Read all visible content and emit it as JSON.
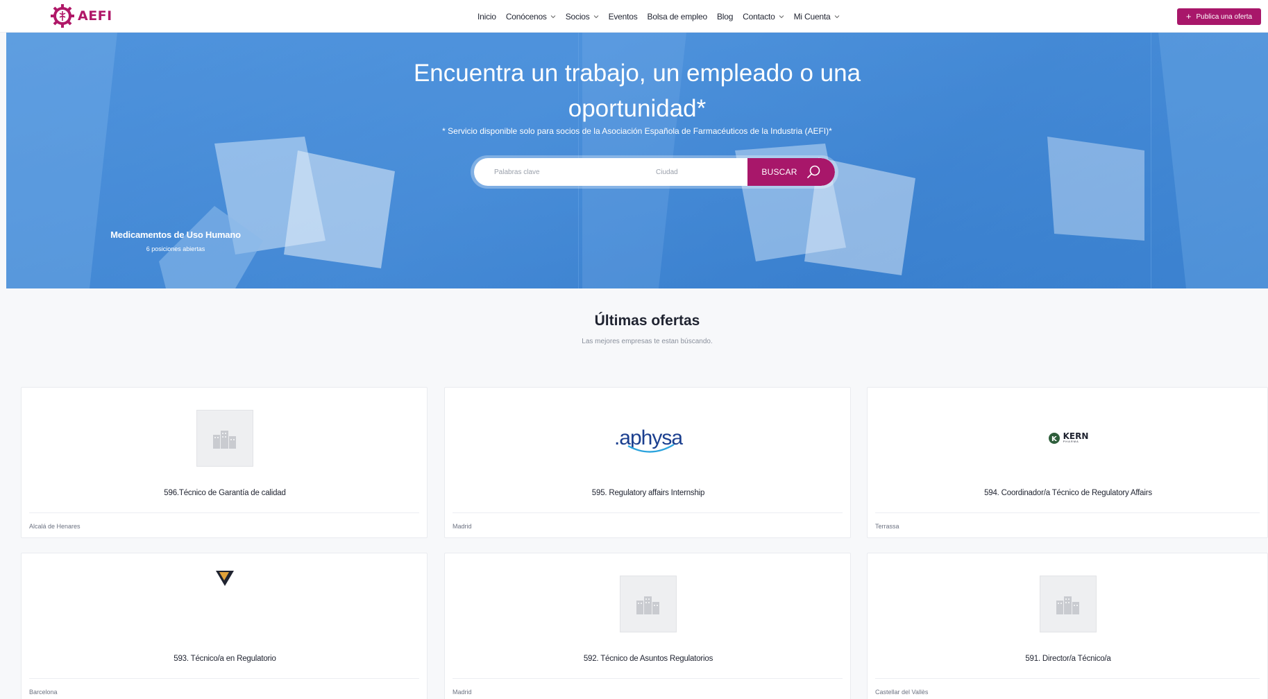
{
  "brand": {
    "name": "AEFI",
    "color": "#b01868"
  },
  "nav": {
    "items": [
      {
        "label": "Inicio",
        "dropdown": false
      },
      {
        "label": "Conócenos",
        "dropdown": true
      },
      {
        "label": "Socios",
        "dropdown": true
      },
      {
        "label": "Eventos",
        "dropdown": false
      },
      {
        "label": "Bolsa de empleo",
        "dropdown": false
      },
      {
        "label": "Blog",
        "dropdown": false
      },
      {
        "label": "Contacto",
        "dropdown": true
      },
      {
        "label": "Mi Cuenta",
        "dropdown": true
      }
    ],
    "post_button": "Publica una oferta"
  },
  "hero": {
    "title": "Encuentra un trabajo, un empleado o una oportunidad*",
    "note": "* Servicio disponible solo para socios de la Asociación Española de Farmacéuticos de la Industria (AEFI)*",
    "search": {
      "keywords_placeholder": "Palabras clave",
      "city_placeholder": "Ciudad",
      "button": "BUSCAR"
    },
    "category": {
      "title": "Medicamentos de Uso Humano",
      "count": "6 posiciones abiertas"
    }
  },
  "offers": {
    "title": "Últimas ofertas",
    "subtitle": "Las mejores empresas te estan búscando.",
    "items": [
      {
        "title": "596.Técnico de Garantía de calidad",
        "location": "Alcalá de Henares",
        "logo": "building-placeholder-icon"
      },
      {
        "title": "595. Regulatory affairs Internship",
        "location": "Madrid",
        "logo": "aphysa-logo",
        "logo_text": ".aphysa"
      },
      {
        "title": "594. Coordinador/a Técnico de Regulatory Affairs",
        "location": "Terrassa",
        "logo": "kern-pharma-logo",
        "logo_text": "KERN",
        "logo_sub": "PHARMA"
      },
      {
        "title": "593. Técnico/a en Regulatorio",
        "location": "Barcelona",
        "logo": "triangle-company-logo"
      },
      {
        "title": "592. Técnico de Asuntos Regulatorios",
        "location": "Madrid",
        "logo": "building-placeholder-icon"
      },
      {
        "title": "591. Director/a Técnico/a",
        "location": "Castellar del Vallès",
        "logo": "building-placeholder-icon"
      }
    ]
  },
  "colors": {
    "accent": "#a8176a",
    "hero_blue": "#4a90dc"
  }
}
